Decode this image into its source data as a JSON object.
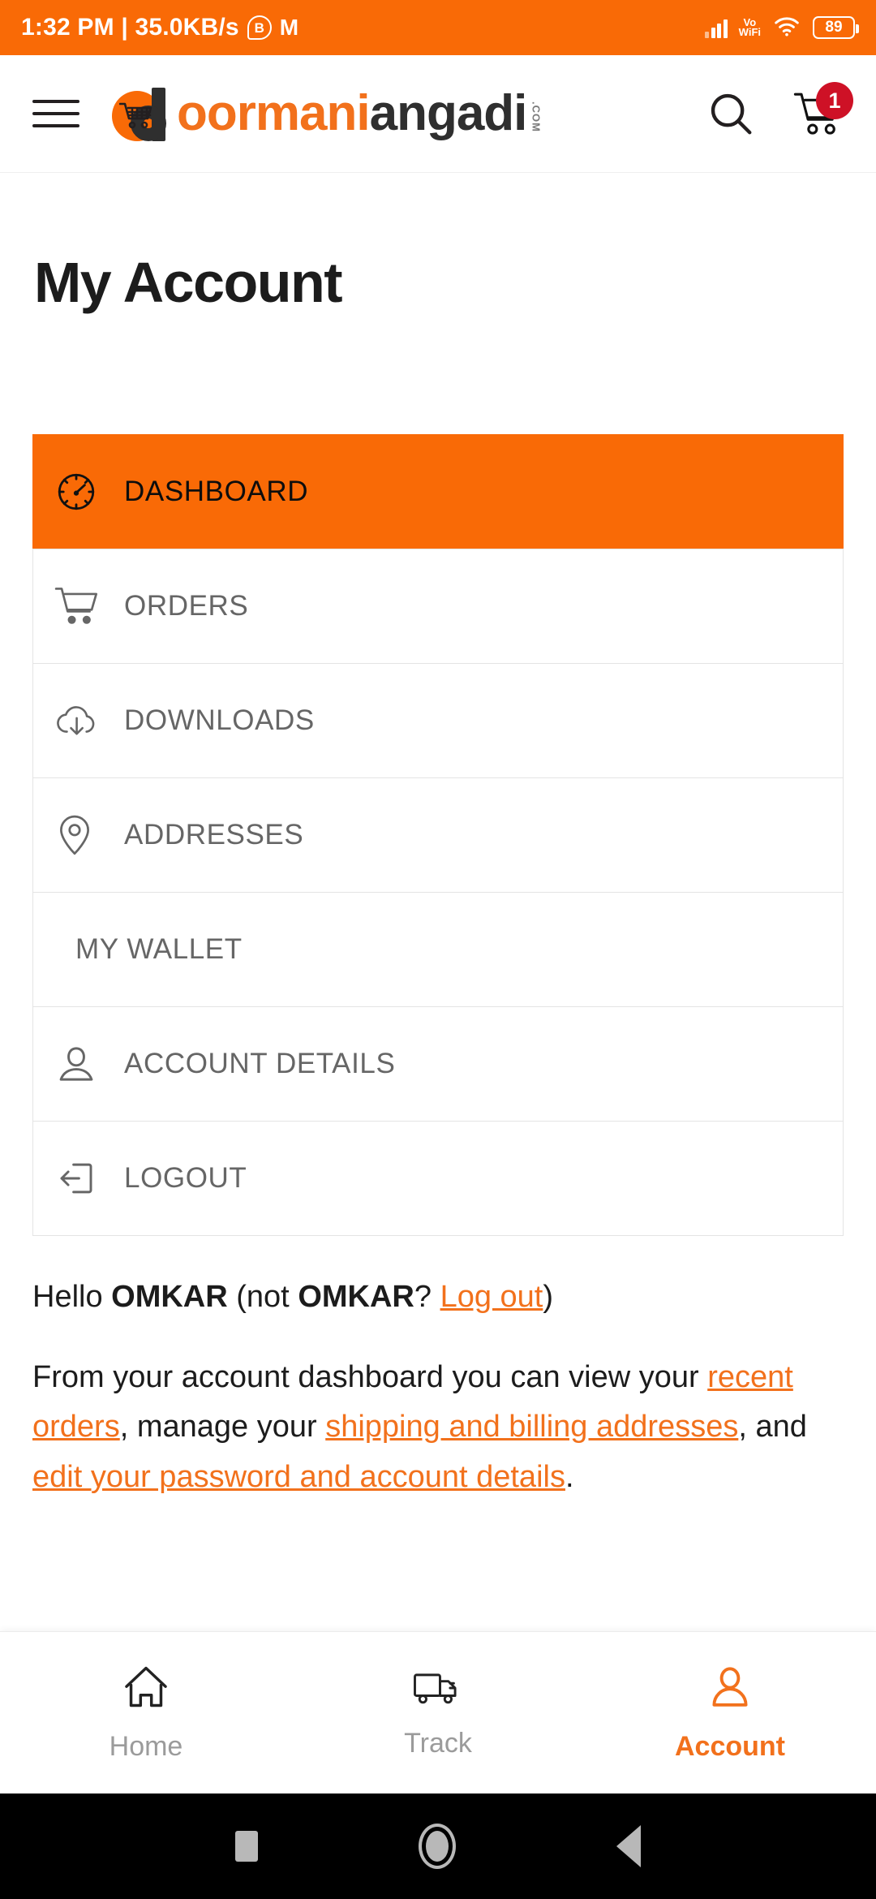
{
  "status_bar": {
    "clock": "1:32 PM | 35.0KB/s",
    "bluetooth_icon": "B",
    "gmail_icon": "M",
    "network_label": "Vo",
    "network_label2": "WiFi",
    "battery_percent": "89"
  },
  "header": {
    "menu_icon": "hamburger-menu-icon",
    "logo": {
      "part1": "oormani",
      "part2": "angadi",
      "tld": ".COM"
    },
    "search_icon": "search-icon",
    "cart_icon": "cart-icon",
    "cart_count": "1"
  },
  "page": {
    "title": "My Account"
  },
  "account_nav": {
    "items": [
      {
        "label": "DASHBOARD",
        "icon": "dashboard-gauge-icon",
        "active": true,
        "has_icon": true
      },
      {
        "label": "ORDERS",
        "icon": "cart-icon",
        "active": false,
        "has_icon": true
      },
      {
        "label": "DOWNLOADS",
        "icon": "cloud-download-icon",
        "active": false,
        "has_icon": true
      },
      {
        "label": "ADDRESSES",
        "icon": "location-pin-icon",
        "active": false,
        "has_icon": true
      },
      {
        "label": "MY WALLET",
        "icon": "",
        "active": false,
        "has_icon": false
      },
      {
        "label": "ACCOUNT DETAILS",
        "icon": "person-icon",
        "active": false,
        "has_icon": true
      },
      {
        "label": "LOGOUT",
        "icon": "logout-icon",
        "active": false,
        "has_icon": true
      }
    ]
  },
  "dashboard": {
    "greeting_prefix": "Hello ",
    "user_name": "OMKAR",
    "greeting_mid": " (not ",
    "user_name2": "OMKAR",
    "greeting_q": "? ",
    "logout_link": "Log out",
    "greeting_suffix": ")",
    "description": {
      "t1": "From your account dashboard you can view your ",
      "l1": "recent orders",
      "t2": ", manage your ",
      "l2": "shipping and billing addresses",
      "t3": ", and ",
      "l3": "edit your password and account details",
      "t4": "."
    }
  },
  "tab_bar": {
    "tabs": [
      {
        "label": "Home",
        "icon": "home-icon",
        "active": false
      },
      {
        "label": "Track",
        "icon": "truck-icon",
        "active": false
      },
      {
        "label": "Account",
        "icon": "person-icon",
        "active": true
      }
    ]
  },
  "system_nav": {
    "recents_icon": "recents-square-icon",
    "home_icon": "home-circle-icon",
    "back_icon": "back-triangle-icon"
  },
  "colors": {
    "brand_orange": "#F96A06",
    "link_orange": "#F2711C",
    "badge_red": "#CE1126",
    "text_dark": "#1c1c1c",
    "text_muted": "#666666"
  }
}
